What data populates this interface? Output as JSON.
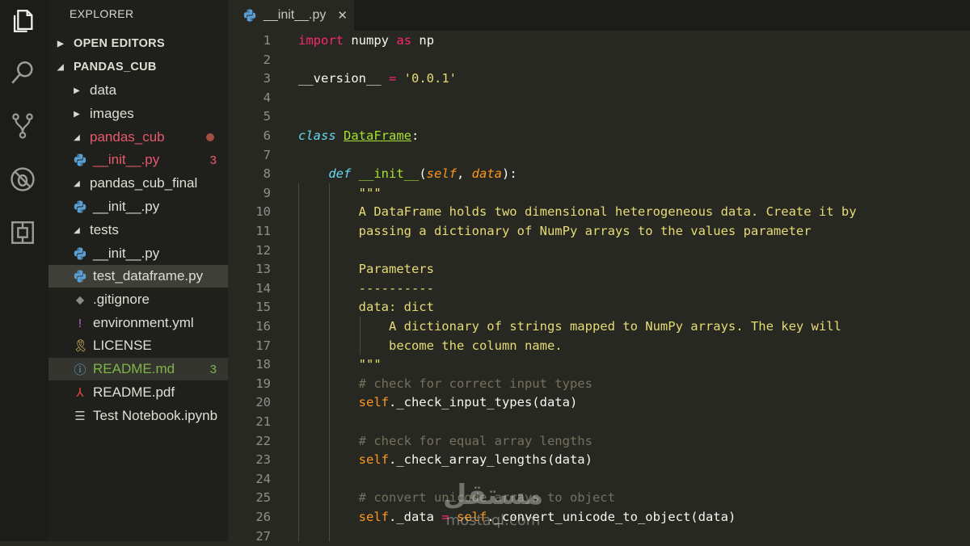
{
  "sidebar": {
    "title": "EXPLORER",
    "tree": [
      {
        "label": "OPEN EDITORS",
        "type": "section",
        "chev": "▶"
      },
      {
        "label": "PANDAS_CUB",
        "type": "section",
        "chev": "◢"
      },
      {
        "label": "data",
        "type": "folder",
        "chev": "▶"
      },
      {
        "label": "images",
        "type": "folder",
        "chev": "▶"
      },
      {
        "label": "pandas_cub",
        "type": "folder",
        "chev": "◢",
        "color": "#e8596f",
        "dot": true
      },
      {
        "label": "__init__.py",
        "type": "py",
        "color": "#e8596f",
        "badge": "3",
        "badge_color": "#e8596f"
      },
      {
        "label": "pandas_cub_final",
        "type": "folder",
        "chev": "◢"
      },
      {
        "label": "__init__.py",
        "type": "py"
      },
      {
        "label": "tests",
        "type": "folder",
        "chev": "◢"
      },
      {
        "label": "__init__.py",
        "type": "py"
      },
      {
        "label": "test_dataframe.py",
        "type": "py",
        "selected": true
      },
      {
        "label": ".gitignore",
        "type": "git"
      },
      {
        "label": "environment.yml",
        "type": "yml"
      },
      {
        "label": "LICENSE",
        "type": "license"
      },
      {
        "label": "README.md",
        "type": "info",
        "color": "#7fb547",
        "badge": "3",
        "badge_color": "#7fb547",
        "highlight": true
      },
      {
        "label": "README.pdf",
        "type": "pdf"
      },
      {
        "label": "Test Notebook.ipynb",
        "type": "list"
      }
    ]
  },
  "tab": {
    "label": "__init__.py",
    "close": "✕"
  },
  "editor": {
    "lines": [
      {
        "n": "1",
        "tokens": [
          [
            "kw",
            "import"
          ],
          [
            "",
            "numpy"
          ],
          [
            "kw",
            "as"
          ],
          [
            "",
            "np"
          ]
        ],
        "sep": " "
      },
      {
        "n": "2",
        "tokens": []
      },
      {
        "n": "3",
        "tokens": [
          [
            "",
            "__version__ "
          ],
          [
            "kw",
            "="
          ],
          [
            "st",
            " '0.0.1'"
          ]
        ]
      },
      {
        "n": "4",
        "tokens": []
      },
      {
        "n": "5",
        "tokens": []
      },
      {
        "n": "6",
        "tokens": [
          [
            "cls",
            "class"
          ],
          [
            "",
            " "
          ],
          [
            "ty",
            "DataFrame"
          ],
          [
            "",
            ":"
          ]
        ]
      },
      {
        "n": "7",
        "tokens": []
      },
      {
        "n": "8",
        "tokens": [
          [
            "",
            "    "
          ],
          [
            "df",
            "def"
          ],
          [
            "",
            " "
          ],
          [
            "fn",
            "__init__"
          ],
          [
            "",
            "("
          ],
          [
            "pm",
            "self"
          ],
          [
            "",
            ", "
          ],
          [
            "pm",
            "data"
          ],
          [
            "",
            "):"
          ]
        ]
      },
      {
        "n": "9",
        "tokens": [
          [
            "st",
            "        \"\"\""
          ]
        ]
      },
      {
        "n": "10",
        "tokens": [
          [
            "st",
            "        A DataFrame holds two dimensional heterogeneous data. Create it by"
          ]
        ]
      },
      {
        "n": "11",
        "tokens": [
          [
            "st",
            "        passing a dictionary of NumPy arrays to the values parameter"
          ]
        ]
      },
      {
        "n": "12",
        "tokens": []
      },
      {
        "n": "13",
        "tokens": [
          [
            "st",
            "        Parameters"
          ]
        ]
      },
      {
        "n": "14",
        "tokens": [
          [
            "st",
            "        ----------"
          ]
        ]
      },
      {
        "n": "15",
        "tokens": [
          [
            "st",
            "        data: dict"
          ]
        ]
      },
      {
        "n": "16",
        "tokens": [
          [
            "st",
            "            A dictionary of strings mapped to NumPy arrays. The key will"
          ]
        ]
      },
      {
        "n": "17",
        "tokens": [
          [
            "st",
            "            become the column name."
          ]
        ]
      },
      {
        "n": "18",
        "tokens": [
          [
            "st",
            "        \"\"\""
          ]
        ]
      },
      {
        "n": "19",
        "tokens": [
          [
            "cm",
            "        # check for correct input types"
          ]
        ]
      },
      {
        "n": "20",
        "tokens": [
          [
            "self",
            "        self"
          ],
          [
            "",
            "._check_input_types(data)"
          ]
        ]
      },
      {
        "n": "21",
        "tokens": []
      },
      {
        "n": "22",
        "tokens": [
          [
            "cm",
            "        # check for equal array lengths"
          ]
        ]
      },
      {
        "n": "23",
        "tokens": [
          [
            "self",
            "        self"
          ],
          [
            "",
            "._check_array_lengths(data)"
          ]
        ]
      },
      {
        "n": "24",
        "tokens": []
      },
      {
        "n": "25",
        "tokens": [
          [
            "cm",
            "        # convert unicode arrays to object"
          ]
        ]
      },
      {
        "n": "26",
        "tokens": [
          [
            "self",
            "        self"
          ],
          [
            "",
            "._data "
          ],
          [
            "kw",
            "="
          ],
          [
            "",
            " "
          ],
          [
            "self",
            "self"
          ],
          [
            "",
            "._convert_unicode_to_object(data)"
          ]
        ]
      },
      {
        "n": "27",
        "tokens": []
      }
    ]
  },
  "watermark": {
    "arabic": "مستقل",
    "latin": "mostaql.com"
  },
  "activity": [
    "files-icon",
    "search-icon",
    "source-control-icon",
    "debug-icon",
    "extensions-icon"
  ]
}
